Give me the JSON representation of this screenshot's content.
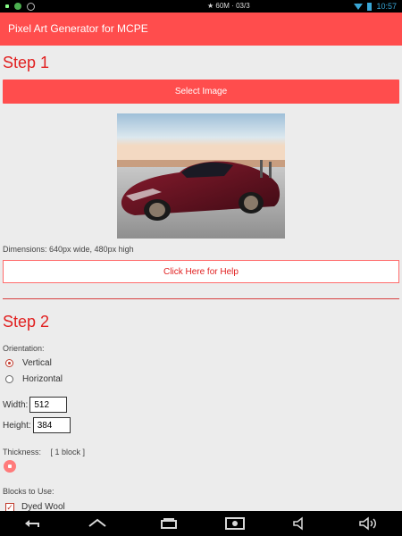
{
  "statusbar": {
    "center_text": "★ 60M · 03/3",
    "time": "10:57"
  },
  "app": {
    "title": "Pixel Art Generator for MCPE"
  },
  "step1": {
    "title": "Step 1",
    "select_button": "Select Image",
    "dimensions": "Dimensions: 640px wide, 480px high",
    "help_button": "Click Here for Help"
  },
  "step2": {
    "title": "Step 2",
    "orientation_label": "Orientation:",
    "orientation_options": [
      "Vertical",
      "Horizontal"
    ],
    "selected_orientation": "Vertical",
    "width_label": "Width:",
    "width_value": "512",
    "height_label": "Height:",
    "height_value": "384",
    "thickness_label": "Thickness:",
    "thickness_value": "[ 1 block ]",
    "blocks_label": "Blocks to Use:",
    "blocks": [
      {
        "label": "Dyed Wool",
        "checked": true
      }
    ]
  },
  "colors": {
    "accent": "#ff4d4d",
    "title": "#e11f1f"
  },
  "icons": [
    "back-icon",
    "home-icon",
    "recent-apps-icon",
    "screenshot-icon",
    "volume-down-icon",
    "volume-up-icon"
  ]
}
